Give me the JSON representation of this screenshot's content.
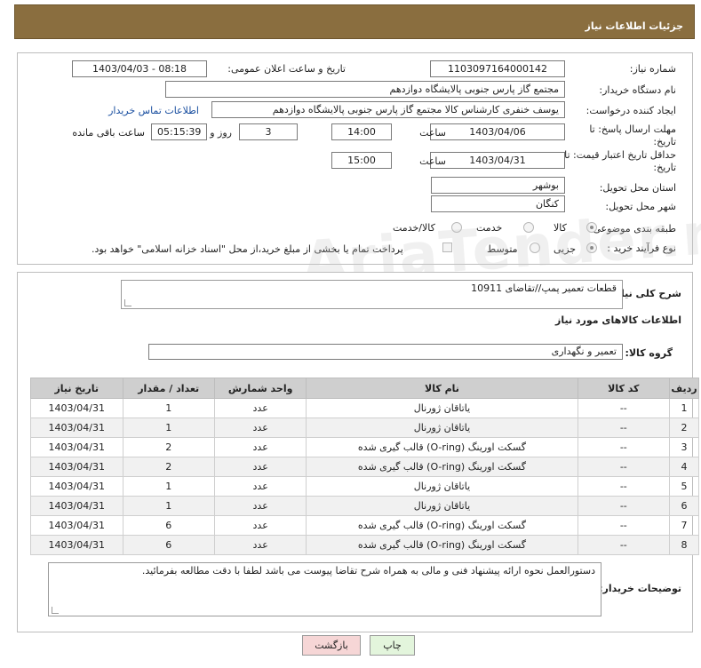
{
  "header": {
    "title": "جزئیات اطلاعات نیاز"
  },
  "form": {
    "need_number_label": "شماره نیاز:",
    "need_number": "1103097164000142",
    "announce_label": "تاریخ و ساعت اعلان عمومی:",
    "announce_value": "1403/04/03 - 08:18",
    "buyer_org_label": "نام دستگاه خریدار:",
    "buyer_org": "مجتمع گاز پارس جنوبی  پالایشگاه دوازدهم",
    "creator_label": "ایجاد کننده درخواست:",
    "creator": "یوسف خنفری کارشناس کالا مجتمع گاز پارس جنوبی  پالایشگاه دوازدهم",
    "contact_link": "اطلاعات تماس خریدار",
    "reply_deadline_label_1": "مهلت ارسال پاسخ: تا",
    "reply_deadline_label_2": "تاریخ:",
    "reply_date": "1403/04/06",
    "time_label": "ساعت",
    "reply_time": "14:00",
    "days": "3",
    "days_label": "روز و",
    "remaining": "05:15:39",
    "remaining_label": "ساعت باقی مانده",
    "price_deadline_label_1": "حداقل تاریخ اعتبار قیمت: تا",
    "price_deadline_label_2": "تاریخ:",
    "price_date": "1403/04/31",
    "price_time": "15:00",
    "province_label": "استان محل تحویل:",
    "province": "بوشهر",
    "city_label": "شهر محل تحویل:",
    "city": "کنگان",
    "category_label": "طبقه بندی موضوعی:",
    "category_options": [
      "کالا",
      "خدمت",
      "کالا/خدمت"
    ],
    "process_label": "نوع فرآیند خرید :",
    "process_options": [
      "جزیی",
      "متوسط"
    ],
    "payment_note": "پرداخت تمام یا بخشی از مبلغ خرید،از محل \"اسناد خزانه اسلامی\" خواهد بود."
  },
  "details": {
    "description_label": "شرح کلی نیاز:",
    "description": "قطعات تعمیر پمپ//تقاضای 10911",
    "goods_info_title": "اطلاعات کالاهای مورد نیاز",
    "group_label": "گروه کالا:",
    "group": "تعمیر و نگهداری",
    "table": {
      "headers": [
        "ردیف",
        "کد کالا",
        "نام کالا",
        "واحد شمارش",
        "تعداد / مقدار",
        "تاریخ نیاز"
      ],
      "rows": [
        [
          "1",
          "--",
          "یاتاقان ژورنال",
          "عدد",
          "1",
          "1403/04/31"
        ],
        [
          "2",
          "--",
          "یاتاقان ژورنال",
          "عدد",
          "1",
          "1403/04/31"
        ],
        [
          "3",
          "--",
          "گسکت اورینگ (O-ring) قالب گیری شده",
          "عدد",
          "2",
          "1403/04/31"
        ],
        [
          "4",
          "--",
          "گسکت اورینگ (O-ring) قالب گیری شده",
          "عدد",
          "2",
          "1403/04/31"
        ],
        [
          "5",
          "--",
          "یاتاقان ژورنال",
          "عدد",
          "1",
          "1403/04/31"
        ],
        [
          "6",
          "--",
          "یاتاقان ژورنال",
          "عدد",
          "1",
          "1403/04/31"
        ],
        [
          "7",
          "--",
          "گسکت اورینگ (O-ring) قالب گیری شده",
          "عدد",
          "6",
          "1403/04/31"
        ],
        [
          "8",
          "--",
          "گسکت اورینگ (O-ring) قالب گیری شده",
          "عدد",
          "6",
          "1403/04/31"
        ]
      ]
    },
    "buyer_notes_label": "توضیحات خریدار:",
    "buyer_notes": "دستورالعمل نحوه ارائه پیشنهاد فنی و مالی به همراه شرح تقاضا پیوست می باشد لطفا با دقت  مطالعه بفرمائید."
  },
  "buttons": {
    "print": "چاپ",
    "back": "بازگشت"
  },
  "colors": {
    "header_bg": "#8a6e3f",
    "table_header_bg": "#cfcfcf",
    "back_button_bg": "#f6d6d6",
    "print_button_bg": "#e3f5dc"
  }
}
